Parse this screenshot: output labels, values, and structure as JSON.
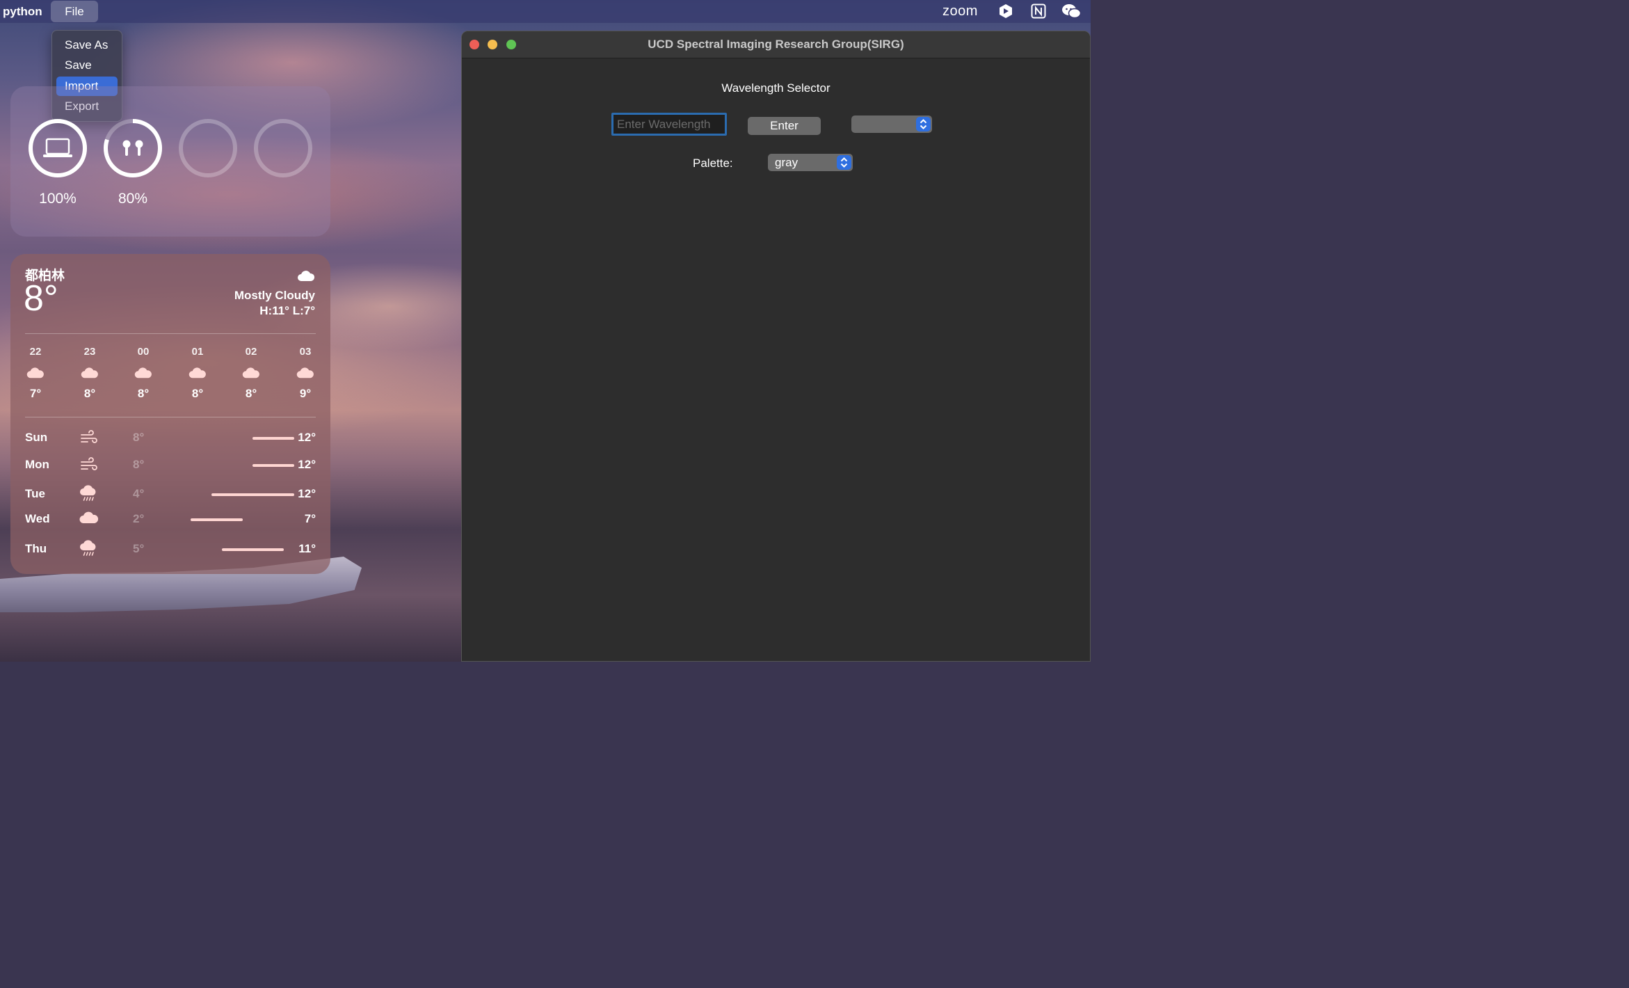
{
  "menubar": {
    "app_name": "python",
    "file_label": "File",
    "zoom_label": "zoom",
    "status_icons": [
      "dropbox-like-icon",
      "notion-icon",
      "wechat-icon"
    ]
  },
  "file_menu": {
    "items": [
      {
        "label": "Save As",
        "selected": false
      },
      {
        "label": "Save",
        "selected": false
      },
      {
        "label": "Import",
        "selected": true
      },
      {
        "label": "Export",
        "selected": false
      }
    ]
  },
  "battery_widget": {
    "devices": [
      {
        "icon": "laptop-icon",
        "percent_label": "100%",
        "level": 1.0
      },
      {
        "icon": "airpods-icon",
        "percent_label": "80%",
        "level": 0.8
      },
      {
        "icon": "",
        "percent_label": "",
        "level": 0
      },
      {
        "icon": "",
        "percent_label": "",
        "level": 0
      }
    ]
  },
  "weather": {
    "city": "都柏林",
    "temperature": "8°",
    "condition": "Mostly Cloudy",
    "high_low": "H:11° L:7°",
    "hourly": [
      {
        "time": "22",
        "temp": "7°",
        "icon": "cloud-icon"
      },
      {
        "time": "23",
        "temp": "8°",
        "icon": "cloud-icon"
      },
      {
        "time": "00",
        "temp": "8°",
        "icon": "cloud-icon"
      },
      {
        "time": "01",
        "temp": "8°",
        "icon": "cloud-icon"
      },
      {
        "time": "02",
        "temp": "8°",
        "icon": "cloud-icon"
      },
      {
        "time": "03",
        "temp": "9°",
        "icon": "cloud-icon"
      }
    ],
    "daily": [
      {
        "day": "Sun",
        "icon": "wind-icon",
        "low": "8°",
        "high": "12°",
        "low_value": 8,
        "high_value": 12
      },
      {
        "day": "Mon",
        "icon": "wind-icon",
        "low": "8°",
        "high": "12°",
        "low_value": 8,
        "high_value": 12
      },
      {
        "day": "Tue",
        "icon": "rain-icon",
        "low": "4°",
        "high": "12°",
        "low_value": 4,
        "high_value": 12
      },
      {
        "day": "Wed",
        "icon": "cloud-icon",
        "low": "2°",
        "high": "7°",
        "low_value": 2,
        "high_value": 7
      },
      {
        "day": "Thu",
        "icon": "rain-icon",
        "low": "5°",
        "high": "11°",
        "low_value": 5,
        "high_value": 11
      }
    ]
  },
  "app_window": {
    "title": "UCD Spectral Imaging Research Group(SIRG)",
    "wavelength_label": "Wavelength Selector",
    "wavelength_placeholder": "Enter Wavelength",
    "enter_label": "Enter",
    "wavelength_dropdown_value": "",
    "palette_label": "Palette:",
    "palette_value": "gray"
  },
  "colors": {
    "accent": "#3a6cd6",
    "traffic_close": "#ed5f57",
    "traffic_min": "#f5bd4f",
    "traffic_max": "#5fc454"
  }
}
